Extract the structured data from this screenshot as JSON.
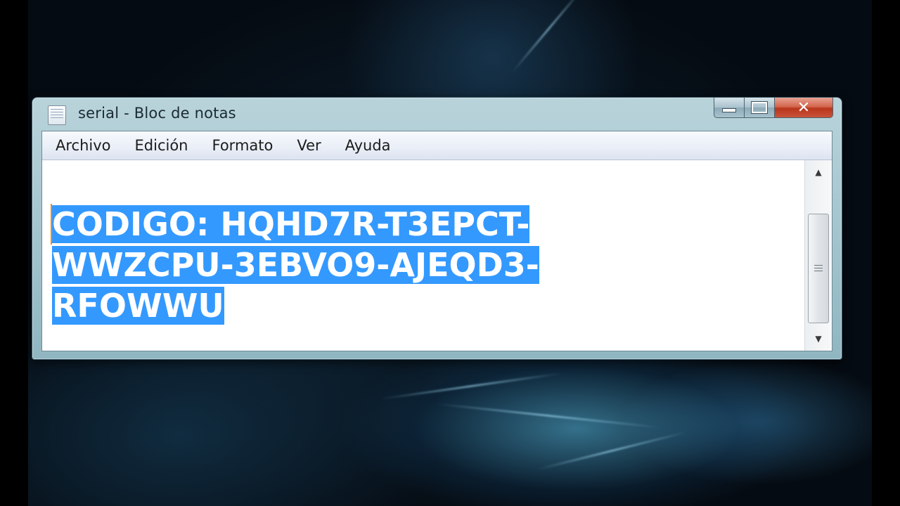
{
  "window": {
    "title": "serial - Bloc de notas",
    "close_glyph": "✕"
  },
  "menu": {
    "items": [
      "Archivo",
      "Edición",
      "Formato",
      "Ver",
      "Ayuda"
    ]
  },
  "document": {
    "line1": "CODIGO: HQHD7R-T3EPCT-",
    "line2": "WWZCPU-3EBVO9-AJEQD3-",
    "line3": "RFOWWU",
    "selection_color": "#3399ff"
  },
  "scrollbar": {
    "up_arrow": "▲",
    "down_arrow": "▼"
  }
}
